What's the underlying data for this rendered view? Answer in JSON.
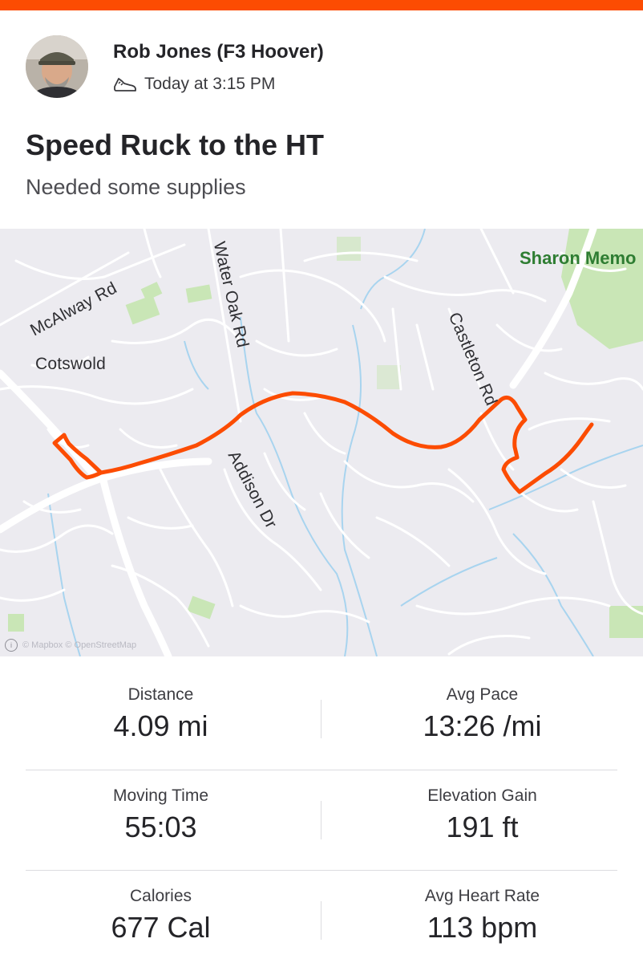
{
  "brand": {
    "accent": "#fc4c02",
    "route_color": "#fc4c02",
    "park_label_color": "#2e7d32"
  },
  "athlete": {
    "name": "Rob Jones (F3 Hoover)",
    "avatar_icon": "profile-photo"
  },
  "activity": {
    "type_icon": "shoe-icon",
    "timestamp": "Today at 3:15 PM",
    "title": "Speed Ruck to the HT",
    "description": "Needed some supplies"
  },
  "map": {
    "labels": {
      "mcalway": "McAlway Rd",
      "water_oak": "Water Oak Rd",
      "cotswold": "Cotswold",
      "castleton": "Castleton Rd",
      "addison": "Addison Dr",
      "sharon": "Sharon Memo"
    },
    "attribution": "© Mapbox © OpenStreetMap",
    "attribution_icon": "info-circle-icon"
  },
  "stats": {
    "distance": {
      "label": "Distance",
      "value": "4.09 mi"
    },
    "avg_pace": {
      "label": "Avg Pace",
      "value": "13:26 /mi"
    },
    "moving_time": {
      "label": "Moving Time",
      "value": "55:03"
    },
    "elevation_gain": {
      "label": "Elevation Gain",
      "value": "191 ft"
    },
    "calories": {
      "label": "Calories",
      "value": "677 Cal"
    },
    "avg_heart_rate": {
      "label": "Avg Heart Rate",
      "value": "113 bpm"
    }
  }
}
